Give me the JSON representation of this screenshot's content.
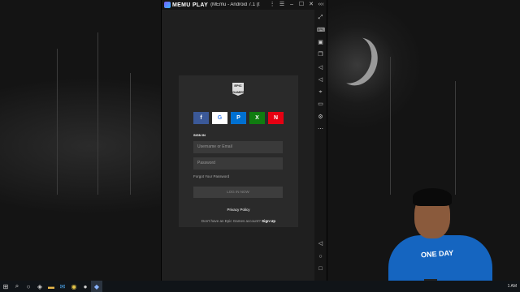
{
  "emulator": {
    "brand": "MEMU PLAY",
    "title": "(MEmu - Android 7.1 (t",
    "buttons": {
      "more": "⋮",
      "menu": "☰",
      "minimize": "–",
      "maximize": "☐",
      "close": "✕",
      "expand": "‹‹‹"
    },
    "sidebar_icons": [
      "fullscreen-icon",
      "keyboard-icon",
      "screenshot-icon",
      "multi-window-icon",
      "volume-up-icon",
      "volume-down-icon",
      "location-icon",
      "folder-icon",
      "settings-icon",
      "more-icon",
      "back-icon",
      "home-icon",
      "recents-icon"
    ]
  },
  "login": {
    "logo_text": "EPIC GAMES",
    "providers": [
      {
        "name": "facebook",
        "glyph": "f",
        "color": "#3b5998",
        "text_color": "#ffffff"
      },
      {
        "name": "google",
        "glyph": "G",
        "color": "#ffffff",
        "text_color": "#4285f4"
      },
      {
        "name": "playstation",
        "glyph": "P",
        "color": "#0070d1",
        "text_color": "#ffffff"
      },
      {
        "name": "xbox",
        "glyph": "X",
        "color": "#107c10",
        "text_color": "#ffffff"
      },
      {
        "name": "nintendo",
        "glyph": "N",
        "color": "#e60012",
        "text_color": "#ffffff"
      }
    ],
    "sign_in_label": "SIGN IN",
    "username_placeholder": "Username or Email",
    "password_placeholder": "Password",
    "forgot_password": "Forgot Your Password",
    "login_button": "LOG IN NOW",
    "privacy_policy": "Privacy Policy",
    "signup_prompt": "Don't have an Epic Games account?",
    "signup_link": "Sign Up"
  },
  "webcam": {
    "shirt_text": "ONE DAY"
  },
  "taskbar": {
    "icons": [
      "windows-start-icon",
      "search-icon",
      "task-view-icon",
      "browser-icon",
      "file-explorer-icon",
      "mail-icon",
      "chrome-icon",
      "obs-icon",
      "memu-icon"
    ],
    "clock": "1 AM"
  }
}
